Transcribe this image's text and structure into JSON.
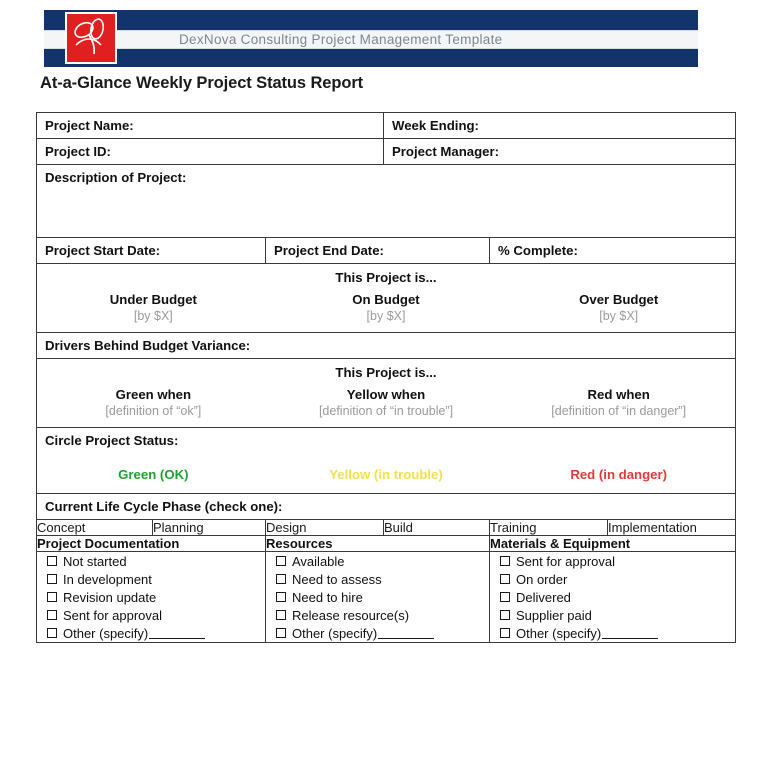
{
  "masthead": {
    "text": "DexNova Consulting  Project Management Template",
    "logo_icon": "dexnova-swirl-logo",
    "navy": "#12336b",
    "logo_red": "#e02020"
  },
  "report": {
    "title": "At-a-Glance Weekly Project Status Report"
  },
  "fields": {
    "project_name": "Project Name:",
    "week_ending": "Week Ending:",
    "project_id": "Project ID:",
    "project_manager": "Project Manager:",
    "description": "Description of Project:",
    "start_date": "Project Start Date:",
    "end_date": "Project End Date:",
    "percent_complete": "% Complete:"
  },
  "budget": {
    "band_title": "This Project is...",
    "options": [
      {
        "main": "Under Budget",
        "sub": "[by $X]"
      },
      {
        "main": "On Budget",
        "sub": "[by $X]"
      },
      {
        "main": "Over Budget",
        "sub": "[by $X]"
      }
    ],
    "drivers_label": "Drivers Behind Budget Variance:"
  },
  "ryg_definitions": {
    "band_title": "This Project is...",
    "options": [
      {
        "main": "Green when",
        "sub": "[definition of “ok”]"
      },
      {
        "main": "Yellow when",
        "sub": "[definition of “in trouble”]"
      },
      {
        "main": "Red when",
        "sub": "[definition of “in danger”]"
      }
    ]
  },
  "circle_status": {
    "label": "Circle Project Status:",
    "options": [
      {
        "text": "Green (OK)",
        "color": "#22a033"
      },
      {
        "text": "Yellow  (in trouble)",
        "color": "#f2e34a"
      },
      {
        "text": "Red  (in danger)",
        "color": "#de3b3b"
      }
    ]
  },
  "life_cycle": {
    "label": "Current Life Cycle Phase (check one):",
    "phases": [
      "Concept",
      "Planning",
      "Design",
      "Build",
      "Training",
      "Implementation"
    ]
  },
  "checklists": [
    {
      "heading": "Project Documentation",
      "items": [
        {
          "label": "Not started",
          "blank": false
        },
        {
          "label": "In development",
          "blank": false
        },
        {
          "label": "Revision update",
          "blank": false
        },
        {
          "label": "Sent for approval",
          "blank": false
        },
        {
          "label": "Other (specify)",
          "blank": true
        }
      ]
    },
    {
      "heading": "Resources",
      "items": [
        {
          "label": "Available",
          "blank": false
        },
        {
          "label": "Need to assess",
          "blank": false
        },
        {
          "label": "Need to hire",
          "blank": false
        },
        {
          "label": "Release resource(s)",
          "blank": false
        },
        {
          "label": "Other (specify)",
          "blank": true
        }
      ]
    },
    {
      "heading": "Materials & Equipment",
      "items": [
        {
          "label": "Sent for approval",
          "blank": false
        },
        {
          "label": "On order",
          "blank": false
        },
        {
          "label": "Delivered",
          "blank": false
        },
        {
          "label": "Supplier paid",
          "blank": false
        },
        {
          "label": "Other (specify)",
          "blank": true
        }
      ]
    }
  ]
}
